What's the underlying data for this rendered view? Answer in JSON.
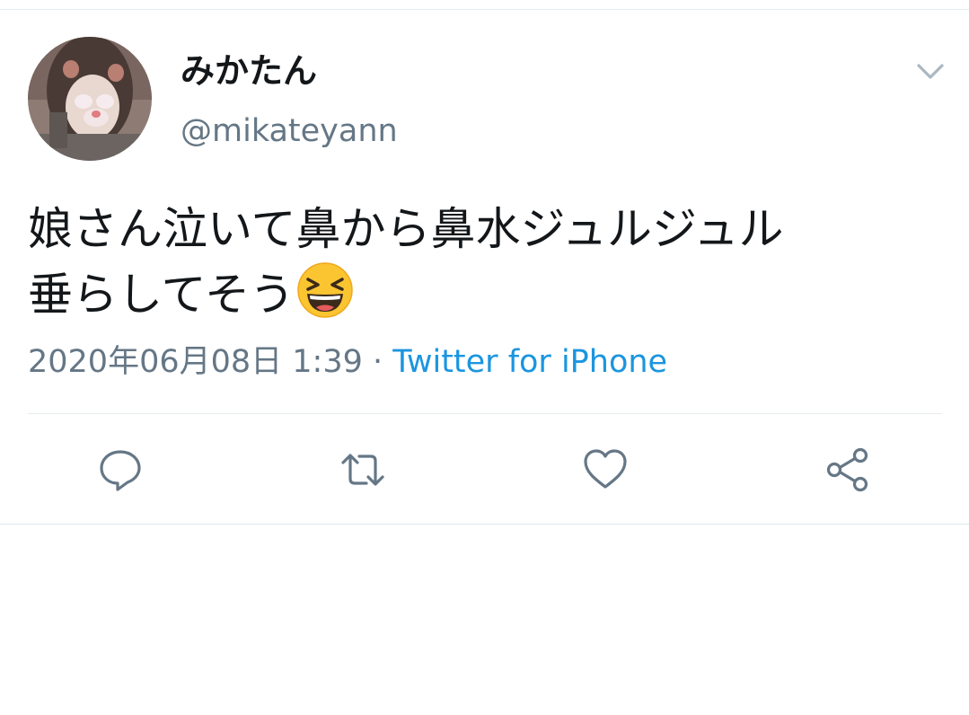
{
  "tweet": {
    "display_name": "みかたん",
    "handle": "@mikateyann",
    "text": "娘さん泣いて鼻から鼻水ジュルジュル\n垂らしてそう",
    "emoji": "grinning-squinting-face",
    "timestamp": "2020年06月08日 1:39",
    "separator": " · ",
    "source": "Twitter for iPhone"
  },
  "actions": {
    "reply": "reply-icon",
    "retweet": "retweet-icon",
    "like": "heart-icon",
    "share": "share-icon"
  },
  "colors": {
    "text": "#14171a",
    "secondary": "#657786",
    "link": "#1b95e0",
    "divider": "#e6ecf0"
  }
}
